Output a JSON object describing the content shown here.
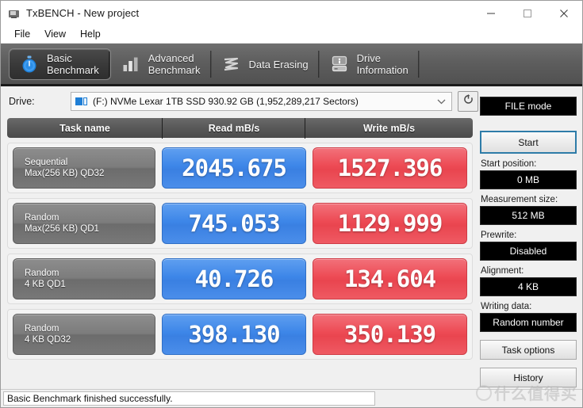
{
  "window": {
    "title": "TxBENCH - New project",
    "icon": "monitor-icon",
    "minimize": "minimize-icon",
    "maximize": "maximize-icon",
    "close": "close-icon"
  },
  "menu": {
    "items": [
      {
        "label": "File"
      },
      {
        "label": "View"
      },
      {
        "label": "Help"
      }
    ]
  },
  "tabs": [
    {
      "label": "Basic\nBenchmark",
      "icon": "stopwatch-icon",
      "active": true
    },
    {
      "label": "Advanced\nBenchmark",
      "icon": "bar-chart-icon",
      "active": false
    },
    {
      "label": "Data Erasing",
      "icon": "eraser-waves-icon",
      "active": false
    },
    {
      "label": "Drive\nInformation",
      "icon": "drive-info-icon",
      "active": false
    }
  ],
  "drive": {
    "label": "Drive:",
    "value": "(F:) NVMe Lexar 1TB SSD  930.92 GB (1,952,289,217 Sectors)",
    "icon": "drive-icon",
    "dropdown_icon": "chevron-down-icon",
    "refresh_icon": "refresh-icon"
  },
  "table": {
    "headers": [
      "Task name",
      "Read mB/s",
      "Write mB/s"
    ],
    "rows": [
      {
        "task_line1": "Sequential",
        "task_line2": "Max(256 KB) QD32",
        "read": "2045.675",
        "write": "1527.396"
      },
      {
        "task_line1": "Random",
        "task_line2": "Max(256 KB) QD1",
        "read": "745.053",
        "write": "1129.999"
      },
      {
        "task_line1": "Random",
        "task_line2": "4 KB QD1",
        "read": "40.726",
        "write": "134.604"
      },
      {
        "task_line1": "Random",
        "task_line2": "4 KB QD32",
        "read": "398.130",
        "write": "350.139"
      }
    ]
  },
  "side": {
    "file_mode": "FILE mode",
    "start_button": "Start",
    "start_position_label": "Start position:",
    "start_position_value": "0 MB",
    "measurement_size_label": "Measurement size:",
    "measurement_size_value": "512 MB",
    "prewrite_label": "Prewrite:",
    "prewrite_value": "Disabled",
    "alignment_label": "Alignment:",
    "alignment_value": "4 KB",
    "writing_data_label": "Writing data:",
    "writing_data_value": "Random number",
    "task_options_button": "Task options",
    "history_button": "History"
  },
  "status": {
    "text": "Basic Benchmark finished successfully."
  },
  "watermark": {
    "text": "什么值得买"
  },
  "colors": {
    "read_blue": "#3d86e8",
    "write_red": "#ed4a54",
    "accent_focus": "#2e7ca8",
    "tabstrip": "#5e5e5e",
    "lcd_bg": "#000000"
  }
}
